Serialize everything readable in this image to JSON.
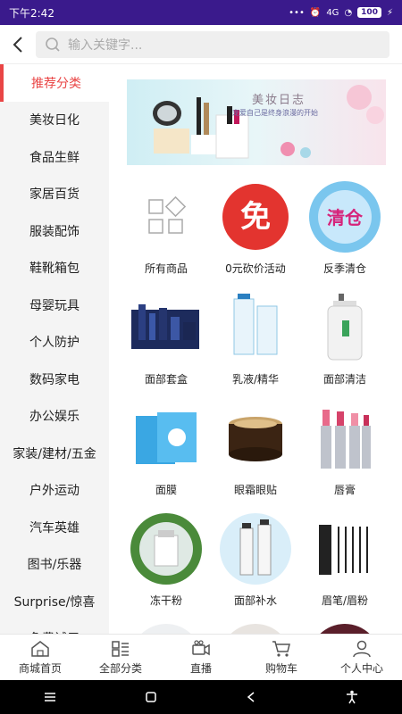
{
  "status": {
    "time": "下午2:42",
    "battery": "100",
    "signal": "4G"
  },
  "search": {
    "placeholder": "输入关键字..."
  },
  "sidebar": {
    "items": [
      {
        "label": "推荐分类"
      },
      {
        "label": "美妆日化"
      },
      {
        "label": "食品生鲜"
      },
      {
        "label": "家居百货"
      },
      {
        "label": "服装配饰"
      },
      {
        "label": "鞋靴箱包"
      },
      {
        "label": "母婴玩具"
      },
      {
        "label": "个人防护"
      },
      {
        "label": "数码家电"
      },
      {
        "label": "办公娱乐"
      },
      {
        "label": "家装/建材/五金"
      },
      {
        "label": "户外运动"
      },
      {
        "label": "汽车英雄"
      },
      {
        "label": "图书/乐器"
      },
      {
        "label": "Surprise/惊喜"
      },
      {
        "label": "免费试用"
      }
    ]
  },
  "banner": {
    "title": "美妆日志",
    "subtitle": "宠爱自己是终身浪漫的开始"
  },
  "grid": {
    "items": [
      {
        "label": "所有商品"
      },
      {
        "label": "0元砍价活动"
      },
      {
        "label": "反季清仓"
      },
      {
        "label": "面部套盒"
      },
      {
        "label": "乳液/精华"
      },
      {
        "label": "面部清洁"
      },
      {
        "label": "面膜"
      },
      {
        "label": "眼霜眼贴"
      },
      {
        "label": "唇膏"
      },
      {
        "label": "冻干粉"
      },
      {
        "label": "面部补水"
      },
      {
        "label": "眉笔/眉粉"
      }
    ],
    "badge_free": "免",
    "badge_clearance": "清仓"
  },
  "bottom_nav": {
    "items": [
      {
        "label": "商城首页",
        "icon": "home-icon"
      },
      {
        "label": "全部分类",
        "icon": "category-icon"
      },
      {
        "label": "直播",
        "icon": "video-camera-icon"
      },
      {
        "label": "购物车",
        "icon": "cart-icon"
      },
      {
        "label": "个人中心",
        "icon": "user-icon"
      }
    ]
  },
  "colors": {
    "accent": "#e94545",
    "status_bar": "#3a1a8c"
  }
}
